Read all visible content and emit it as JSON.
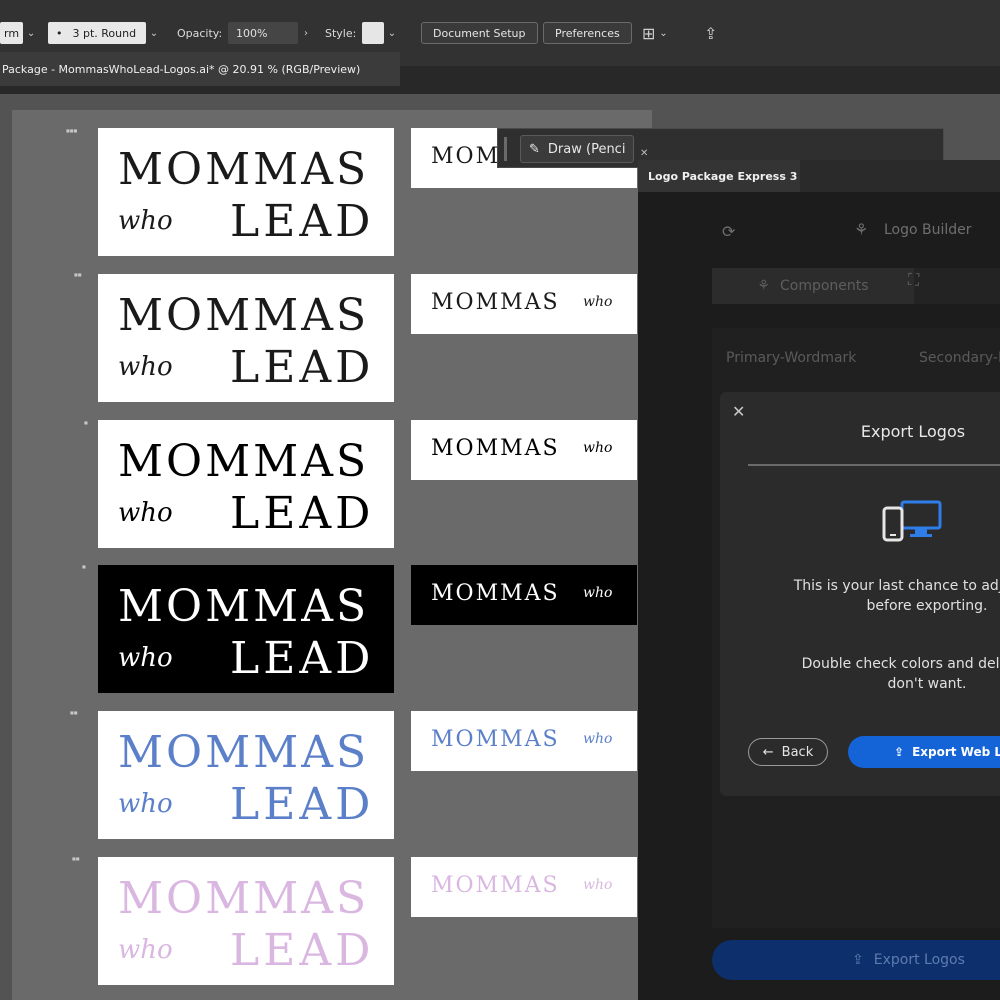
{
  "control_bar": {
    "stroke_prefix": "rm",
    "stroke_profile": "3 pt. Round",
    "opacity_label": "Opacity:",
    "opacity_value": "100%",
    "style_label": "Style:",
    "document_setup": "Document Setup",
    "preferences": "Preferences"
  },
  "document": {
    "tab_title": "Package - MommasWhoLead-Logos.ai* @ 20.91 % (RGB/Preview)"
  },
  "logos": {
    "word_mommas": "MOMMAS",
    "word_who": "who",
    "word_lead": "LEAD",
    "small_mommas_partial": "MOM",
    "colors": {
      "black": "#1a1a1a",
      "pure_black": "#000000",
      "white": "#ffffff",
      "blue": "#5b7fc9",
      "pink": "#d9b7e0"
    }
  },
  "floating_toolbar": {
    "draw_label": "Draw (Penci"
  },
  "plugin_panel": {
    "tab_title": "Logo Package Express 3",
    "builder_title": "Logo Builder",
    "components_tab": "Components",
    "component_1": "Primary-Wordmark",
    "component_2": "Secondary-H",
    "export_logos_button": "Export Logos"
  },
  "modal": {
    "title": "Export Logos",
    "line1": "This is your last chance to adjust your",
    "line2": "before exporting.",
    "line3": "Double check colors and delete any",
    "line4": "don't want.",
    "back_label": "Back",
    "export_web_label": "Export Web L"
  }
}
